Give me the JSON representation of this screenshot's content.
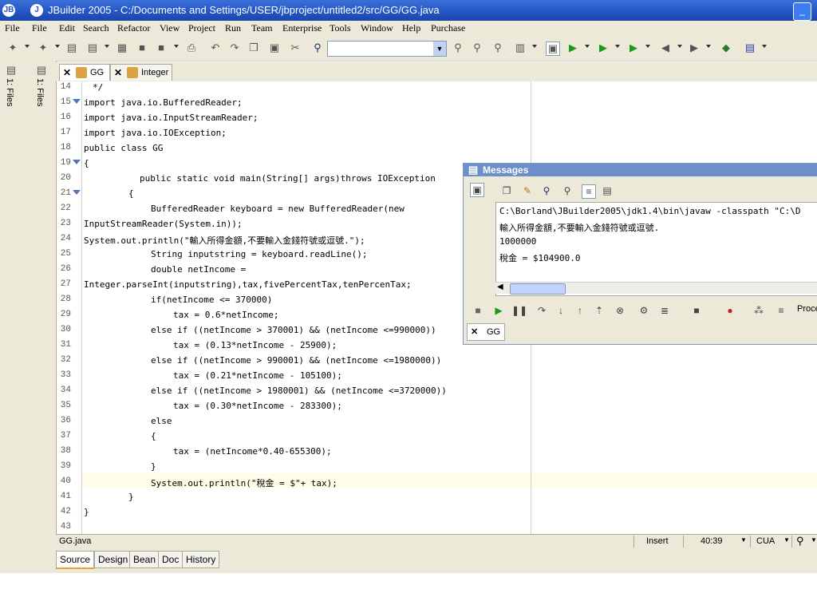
{
  "window": {
    "app_icon_text": "JB",
    "title": "JBuilder 2005 - C:/Documents and Settings/USER/jbproject/untitled2/src/GG/GG.java",
    "minimize": "_"
  },
  "menu": [
    "File",
    "File",
    "Edit",
    "Search",
    "Refactor",
    "View",
    "Project",
    "Run",
    "Team",
    "Enterprise",
    "Tools",
    "Window",
    "Help",
    "Purchase"
  ],
  "left_tabs": {
    "files1": "1: Files",
    "files2": "1: Files"
  },
  "editor_tabs": [
    {
      "label": "GG",
      "close": "✕"
    },
    {
      "label": "Integer",
      "close": "✕"
    }
  ],
  "code": {
    "line_numbers": [
      "14",
      "15",
      "16",
      "17",
      "18",
      "19",
      "20",
      "21",
      "22",
      "23",
      "24",
      "25",
      "26",
      "27",
      "28",
      "29",
      "30",
      "31",
      "32",
      "33",
      "34",
      "35",
      "36",
      "37",
      "38",
      "39",
      "40",
      "41",
      "42",
      "43"
    ],
    "lines": [
      "*/",
      "import java.io.BufferedReader;",
      "import java.io.InputStreamReader;",
      "import java.io.IOException;",
      "public class GG",
      "{",
      "public static void main(String[] args)throws IOException",
      "{",
      "BufferedReader keyboard = new BufferedReader(new",
      "InputStreamReader(System.in));",
      "System.out.println(\"輸入所得金額,不要輸入金錢符號或逗號.\");",
      "String inputstring = keyboard.readLine();",
      "double netIncome =",
      "Integer.parseInt(inputstring),tax,fivePercentTax,tenPercenTax;",
      "if(netIncome <= 370000)",
      "tax = 0.6*netIncome;",
      "else if ((netIncome > 370001) && (netIncome <=990000))",
      "tax = (0.13*netIncome - 25900);",
      "else if ((netIncome > 990001) && (netIncome <=1980000))",
      "tax = (0.21*netIncome - 105100);",
      "else if ((netIncome > 1980001) && (netIncome <=3720000))",
      "tax = (0.30*netIncome - 283300);",
      "else",
      "{",
      "tax = (netIncome*0.40-655300);",
      "}",
      "System.out.println(\"稅金 = $\"+ tax);",
      "}",
      "}",
      ""
    ]
  },
  "messages": {
    "title": "Messages",
    "output": [
      "C:\\Borland\\JBuilder2005\\jdk1.4\\bin\\javaw -classpath \"C:\\D",
      "輸入所得金額,不要輸入金錢符號或逗號.",
      "1000000",
      "稅金 = $104900.0"
    ],
    "process_label": "Proce",
    "tab": {
      "label": "GG",
      "close": "✕"
    }
  },
  "status": {
    "file": "GG.java",
    "mode": "Insert",
    "position": "40:39",
    "keymap": "CUA"
  },
  "bottom_tabs": [
    "Source",
    "Design",
    "Bean",
    "Doc",
    "History"
  ]
}
